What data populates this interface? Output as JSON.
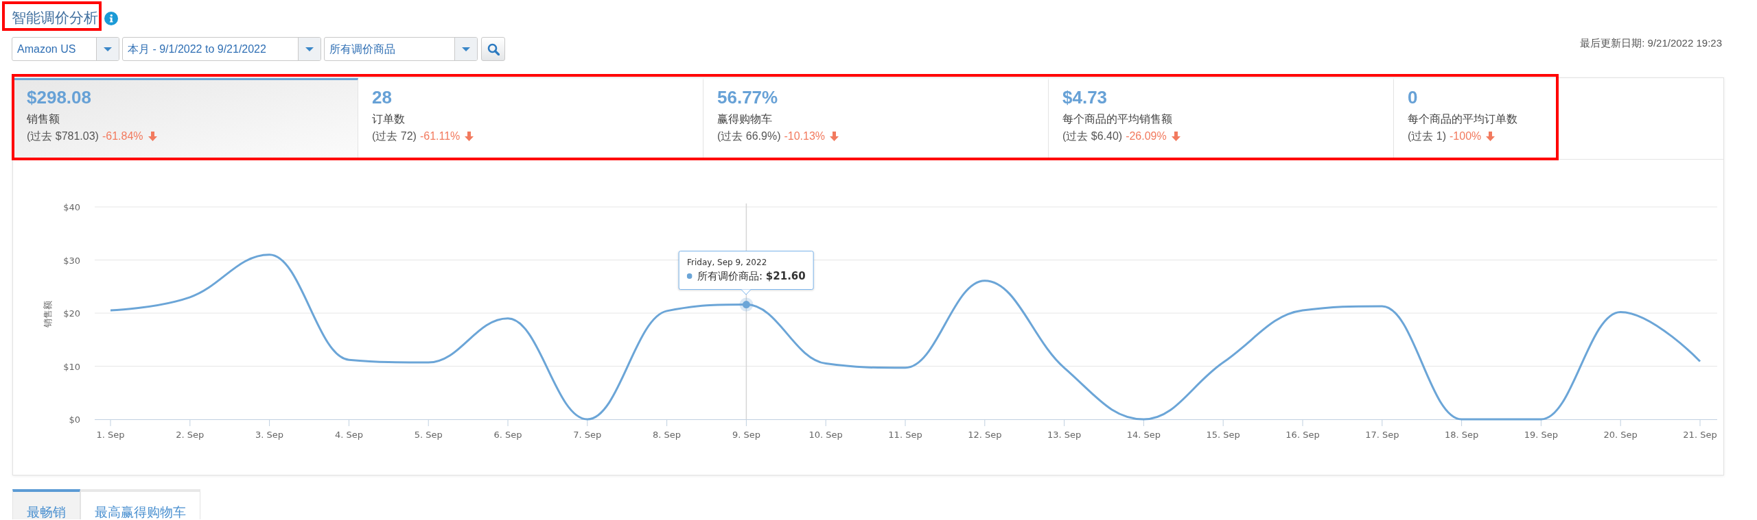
{
  "title": {
    "text": "智能调价分析",
    "highlighted": true
  },
  "filters": [
    {
      "value": "Amazon US"
    },
    {
      "value": "本月 - 9/1/2022 to 9/21/2022"
    },
    {
      "value": "所有调价商品"
    }
  ],
  "last_updated": "最后更新日期: 9/21/2022 19:23",
  "stats": {
    "highlighted": true,
    "items": [
      {
        "value": "$298.08",
        "label": "销售额",
        "previous": "(过去 $781.03)",
        "change": "-61.84%",
        "falling": true,
        "selected": true
      },
      {
        "value": "28",
        "label": "订单数",
        "previous": "(过去 72)",
        "change": "-61.11%",
        "falling": true,
        "selected": false
      },
      {
        "value": "56.77%",
        "label": "赢得购物车",
        "previous": "(过去 66.9%)",
        "change": "-10.13%",
        "falling": true,
        "selected": false
      },
      {
        "value": "$4.73",
        "label": "每个商品的平均销售额",
        "previous": "(过去 $6.40)",
        "change": "-26.09%",
        "falling": true,
        "selected": false
      },
      {
        "value": "0",
        "label": "每个商品的平均订单数",
        "previous": "(过去 1)",
        "change": "-100%",
        "falling": true,
        "selected": false
      }
    ]
  },
  "chart": {
    "tooltip_title": "Friday, Sep 9, 2022",
    "chart_data": {
      "type": "line",
      "ylabel": "销售额",
      "categories": [
        "1. Sep",
        "2. Sep",
        "3. Sep",
        "4. Sep",
        "5. Sep",
        "6. Sep",
        "7. Sep",
        "8. Sep",
        "9. Sep",
        "10. Sep",
        "11. Sep",
        "12. Sep",
        "13. Sep",
        "14. Sep",
        "15. Sep",
        "16. Sep",
        "17. Sep",
        "18. Sep",
        "19. Sep",
        "20. Sep",
        "21. Sep"
      ],
      "values": [
        20.5,
        23,
        31,
        11.2,
        10.7,
        19,
        0,
        20.4,
        21.6,
        10.5,
        9.7,
        26.1,
        9.7,
        0,
        10.7,
        20.5,
        21.3,
        0,
        0,
        20.2,
        10.9
      ],
      "ylim": [
        0,
        40
      ],
      "yticks": [
        {
          "value": 0,
          "label": "$0"
        },
        {
          "value": 10,
          "label": "$10"
        },
        {
          "value": 20,
          "label": "$20"
        },
        {
          "value": 30,
          "label": "$30"
        },
        {
          "value": 40,
          "label": "$40"
        }
      ],
      "grid": true,
      "ref_lines": [
        {
          "axis": "x",
          "value": "9. Sep"
        }
      ],
      "annotations": [
        {
          "x": "9. Sep",
          "y": 21.6,
          "text": "所有调价商品: **$21.60**"
        }
      ]
    }
  },
  "tabs": [
    {
      "label": "最畅销",
      "selected": true
    },
    {
      "label": "最高赢得购物车",
      "selected": false
    }
  ]
}
